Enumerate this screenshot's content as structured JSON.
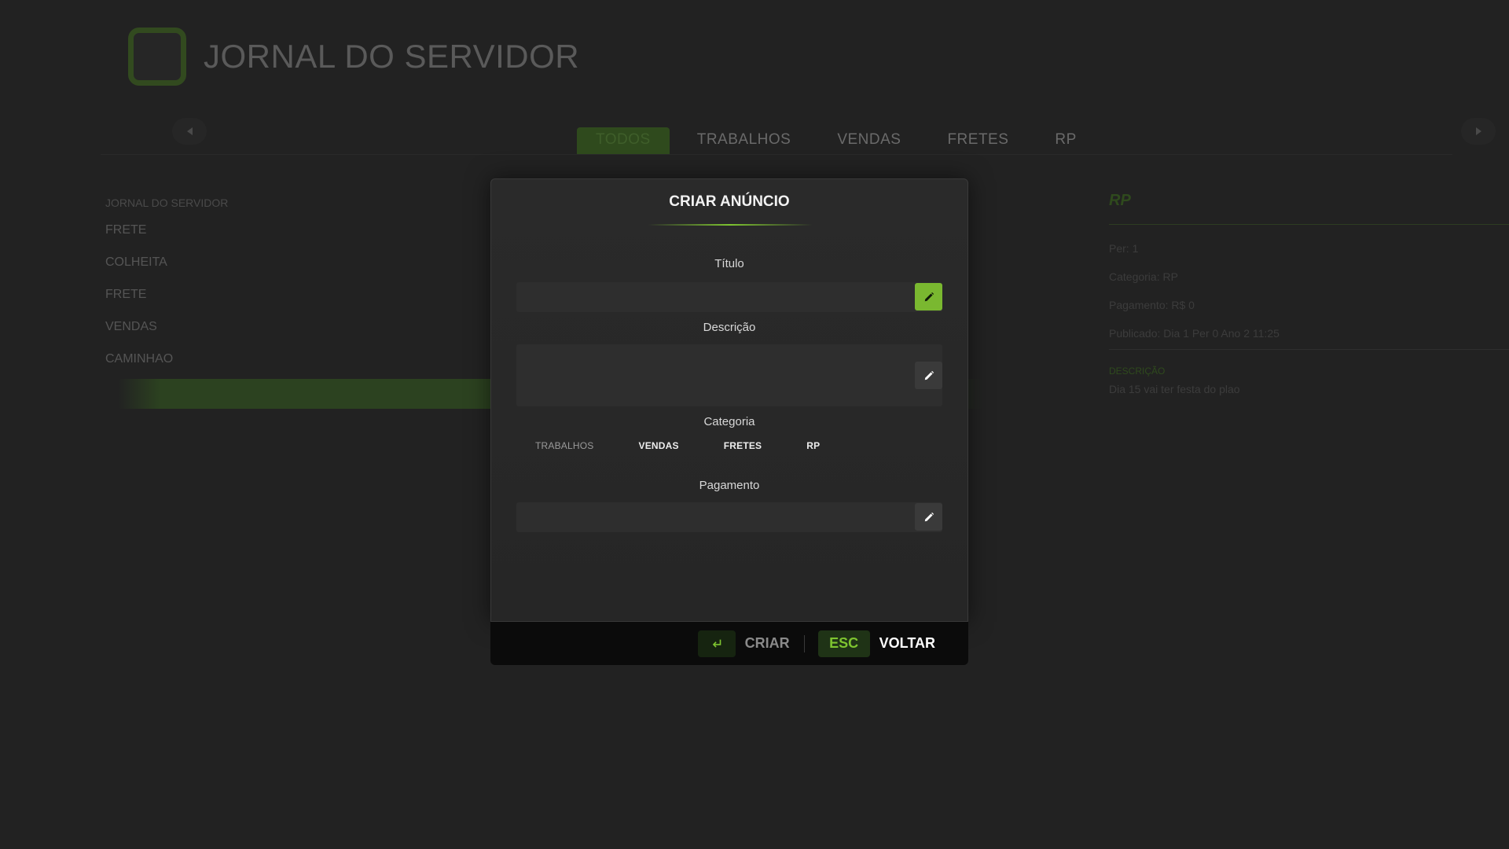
{
  "app": {
    "title": "JORNAL DO SERVIDOR"
  },
  "tabs": [
    {
      "label": "TODOS",
      "active": true
    },
    {
      "label": "TRABALHOS",
      "active": false
    },
    {
      "label": "VENDAS",
      "active": false
    },
    {
      "label": "FRETES",
      "active": false
    },
    {
      "label": "RP",
      "active": false
    }
  ],
  "list": {
    "heading": "JORNAL DO SERVIDOR",
    "items": [
      "FRETE",
      "COLHEITA",
      "FRETE",
      "VENDAS",
      "CAMINHAO"
    ]
  },
  "details": {
    "title": "RP",
    "per": "Per: 1",
    "categoria": "Categoria: RP",
    "pagamento": "Pagamento: R$ 0",
    "publicado": "Publicado: Dia 1 Per 0 Ano 2 11:25",
    "descricao_label": "DESCRIÇÃO",
    "descricao": "Dia 15 vai ter festa do plao"
  },
  "modal": {
    "title": "CRIAR ANÚNCIO",
    "titulo_label": "Título",
    "titulo_value": "",
    "descricao_label": "Descrição",
    "descricao_value": "",
    "categoria_label": "Categoria",
    "categorias": [
      {
        "label": "TRABALHOS",
        "selected": false
      },
      {
        "label": "VENDAS",
        "selected": true
      },
      {
        "label": "FRETES",
        "selected": true
      },
      {
        "label": "RP",
        "selected": true
      }
    ],
    "pagamento_label": "Pagamento",
    "pagamento_value": ""
  },
  "footer": {
    "enter_key_icon": "enter-icon",
    "criar_label": "CRIAR",
    "esc_key_label": "ESC",
    "voltar_label": "VOLTAR"
  },
  "colors": {
    "accent": "#7ec430",
    "background": "#222222",
    "modal": "#2a2a2a"
  }
}
